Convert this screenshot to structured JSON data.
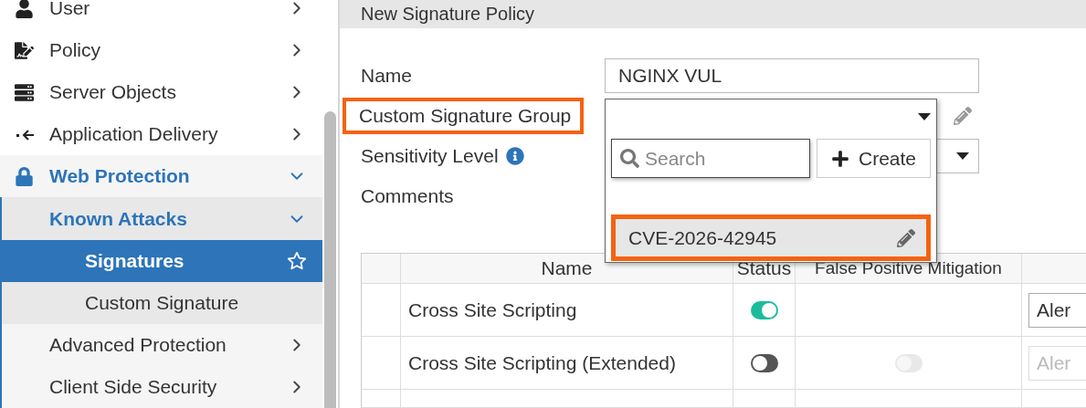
{
  "sidebar": {
    "items": [
      {
        "label": "User",
        "expanded": false
      },
      {
        "label": "Policy",
        "expanded": false
      },
      {
        "label": "Server Objects",
        "expanded": false
      },
      {
        "label": "Application Delivery",
        "expanded": false
      },
      {
        "label": "Web Protection",
        "expanded": true,
        "children": [
          {
            "label": "Known Attacks",
            "expanded": true,
            "children": [
              {
                "label": "Signatures",
                "selected": true
              },
              {
                "label": "Custom Signature",
                "selected": false
              }
            ]
          },
          {
            "label": "Advanced Protection",
            "expanded": false
          },
          {
            "label": "Client Side Security",
            "expanded": false
          }
        ]
      }
    ]
  },
  "page": {
    "title": "New Signature Policy"
  },
  "form": {
    "fields": [
      {
        "kind": "text",
        "label": "Name",
        "value": "NGINX VUL",
        "highlighted": false
      },
      {
        "kind": "group",
        "label": "Custom Signature Group",
        "highlighted": true,
        "open": true,
        "search_placeholder": "Search",
        "create_label": "Create",
        "options": [
          {
            "label": "CVE-2026-42945",
            "highlighted": true
          }
        ]
      },
      {
        "kind": "select",
        "label": "Sensitivity Level",
        "highlighted": false,
        "info": true
      },
      {
        "kind": "textarea",
        "label": "Comments",
        "highlighted": false
      }
    ]
  },
  "table": {
    "columns": [
      "Name",
      "Status",
      "False Positive Mitigation"
    ],
    "rows": [
      {
        "name": "Cross Site Scripting",
        "status": true,
        "mitigation": null,
        "action": "Aler",
        "action_disabled": false
      },
      {
        "name": "Cross Site Scripting (Extended)",
        "status": false,
        "mitigation": {
          "on": false,
          "disabled": true
        },
        "action": "Aler",
        "action_disabled": true
      }
    ]
  }
}
